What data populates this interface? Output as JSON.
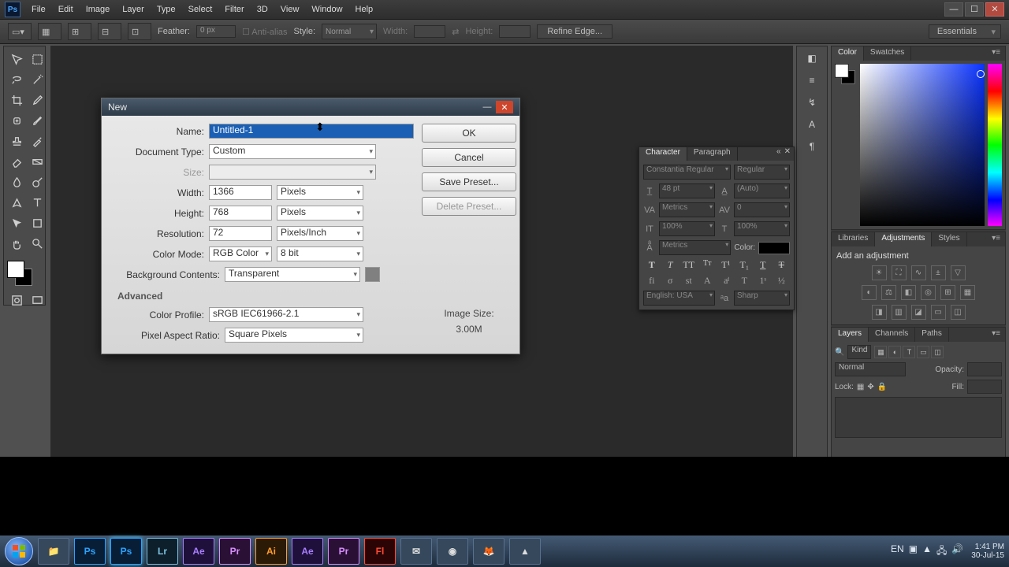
{
  "menu": {
    "items": [
      "File",
      "Edit",
      "Image",
      "Layer",
      "Type",
      "Select",
      "Filter",
      "3D",
      "View",
      "Window",
      "Help"
    ]
  },
  "options_bar": {
    "feather_label": "Feather:",
    "feather_value": "0 px",
    "antialias": "Anti-alias",
    "style_label": "Style:",
    "style_value": "Normal",
    "width_label": "Width:",
    "height_label": "Height:",
    "refine": "Refine Edge...",
    "workspace": "Essentials"
  },
  "panels": {
    "color_tabs": [
      "Color",
      "Swatches"
    ],
    "adj_tabs": [
      "Libraries",
      "Adjustments",
      "Styles"
    ],
    "adj_title": "Add an adjustment",
    "layer_tabs": [
      "Layers",
      "Channels",
      "Paths"
    ],
    "layer_search": "Kind",
    "layer_blend": "Normal",
    "layer_opacity_label": "Opacity:",
    "layer_lock_label": "Lock:",
    "layer_fill_label": "Fill:"
  },
  "char_panel": {
    "tabs": [
      "Character",
      "Paragraph"
    ],
    "font": "Constantia Regular",
    "weight": "Regular",
    "size": "48 pt",
    "leading": "(Auto)",
    "va": "Metrics",
    "kern": "0",
    "scaleH": "100%",
    "scaleV": "100%",
    "baseline": "Metrics",
    "color_label": "Color:",
    "lang": "English: USA",
    "aa": "Sharp"
  },
  "dialog": {
    "title": "New",
    "labels": {
      "name": "Name:",
      "doctype": "Document Type:",
      "size": "Size:",
      "width": "Width:",
      "height": "Height:",
      "resolution": "Resolution:",
      "colormode": "Color Mode:",
      "bgcontents": "Background Contents:",
      "advanced": "Advanced",
      "profile": "Color Profile:",
      "pixelaspect": "Pixel Aspect Ratio:",
      "imgsize_label": "Image Size:"
    },
    "values": {
      "name": "Untitled-1",
      "doctype": "Custom",
      "size": "",
      "width": "1366",
      "height": "768",
      "resolution": "72",
      "colormode": "RGB Color",
      "depth": "8 bit",
      "bgcontents": "Transparent",
      "profile": "sRGB IEC61966-2.1",
      "pixelaspect": "Square Pixels",
      "imgsize": "3.00M",
      "width_unit": "Pixels",
      "height_unit": "Pixels",
      "res_unit": "Pixels/Inch"
    },
    "buttons": {
      "ok": "OK",
      "cancel": "Cancel",
      "save": "Save Preset...",
      "delete": "Delete Preset..."
    }
  },
  "taskbar": {
    "clock_time": "1:41 PM",
    "clock_date": "30-Jul-15",
    "lang": "EN"
  }
}
